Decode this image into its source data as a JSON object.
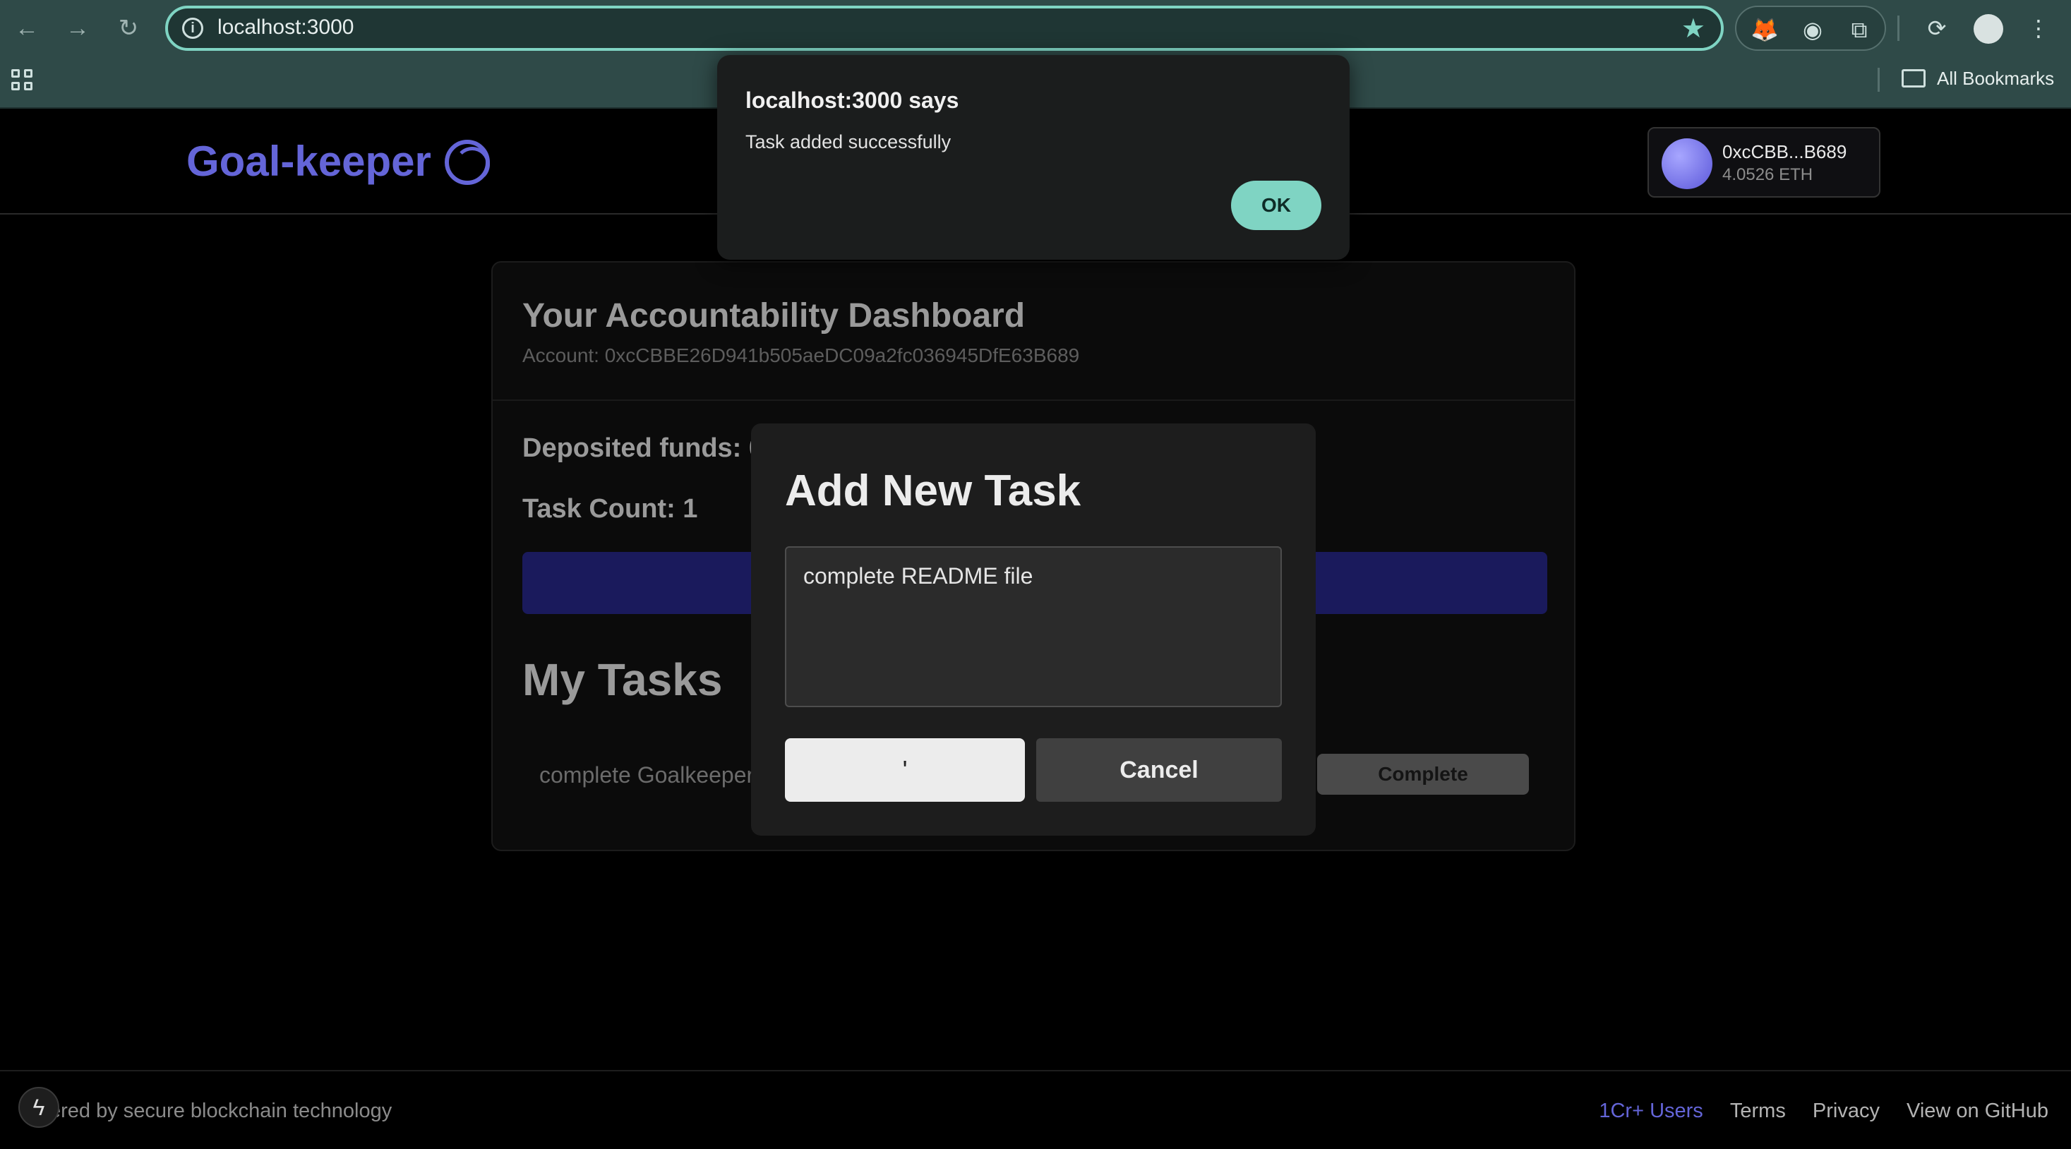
{
  "browser": {
    "url": "localhost:3000",
    "bookmarks_label": "All Bookmarks",
    "accent_color": "#7fd4c3"
  },
  "app": {
    "brand": "Goal-keeper",
    "brand_color": "#6465d8",
    "wallet": {
      "address": "0xcCBB...B689",
      "balance": "4.0526 ETH"
    }
  },
  "dashboard": {
    "title": "Your Accountability Dashboard",
    "account": "Account: 0xcCBBE26D941b505aeDC09a2fc036945DfE63B689",
    "deposited": "Deposited funds: 0.",
    "task_count": "Task Count: 1",
    "my_tasks_heading": "My Tasks",
    "tasks": [
      {
        "text": "complete Goalkeeper",
        "action": "Complete"
      }
    ]
  },
  "modal": {
    "title": "Add New Task",
    "task_value": "complete README file",
    "add_label": "'",
    "cancel_label": "Cancel"
  },
  "alert": {
    "title": "localhost:3000 says",
    "message": "Task added successfully",
    "ok_label": "OK"
  },
  "footer": {
    "tagline": "ered by secure blockchain technology",
    "links": [
      "1Cr+ Users",
      "Terms",
      "Privacy",
      "View on GitHub"
    ]
  }
}
